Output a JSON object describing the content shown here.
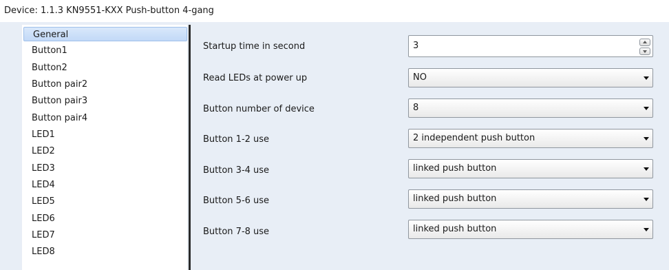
{
  "window": {
    "title": "Device: 1.1.3  KN9551-KXX Push-button 4-gang"
  },
  "sidebar": {
    "items": [
      {
        "label": "General",
        "selected": true
      },
      {
        "label": "Button1"
      },
      {
        "label": "Button2"
      },
      {
        "label": "Button pair2"
      },
      {
        "label": "Button pair3"
      },
      {
        "label": "Button pair4"
      },
      {
        "label": "LED1"
      },
      {
        "label": "LED2"
      },
      {
        "label": "LED3"
      },
      {
        "label": "LED4"
      },
      {
        "label": "LED5"
      },
      {
        "label": "LED6"
      },
      {
        "label": "LED7"
      },
      {
        "label": "LED8"
      }
    ]
  },
  "parameters": [
    {
      "label": "Startup time in second",
      "value": "3",
      "control": "spinbox"
    },
    {
      "label": "Read LEDs at power up",
      "value": "NO",
      "control": "dropdown"
    },
    {
      "label": "Button number of device",
      "value": "8",
      "control": "dropdown"
    },
    {
      "label": "Button 1-2 use",
      "value": "2 independent push button",
      "control": "dropdown"
    },
    {
      "label": "Button 3-4 use",
      "value": "linked push button",
      "control": "dropdown"
    },
    {
      "label": "Button 5-6 use",
      "value": "linked push button",
      "control": "dropdown"
    },
    {
      "label": "Button 7-8 use",
      "value": "linked push button",
      "control": "dropdown"
    }
  ],
  "icons": {
    "dropdown": "chevron-down-icon",
    "spin_up": "spin-up-icon",
    "spin_down": "spin-down-icon"
  },
  "colors": {
    "panel_background": "#e8eef6",
    "selection_fill": "#c2d9f7",
    "selection_border": "#9fc0ea",
    "splitter": "#2b2b2b"
  }
}
